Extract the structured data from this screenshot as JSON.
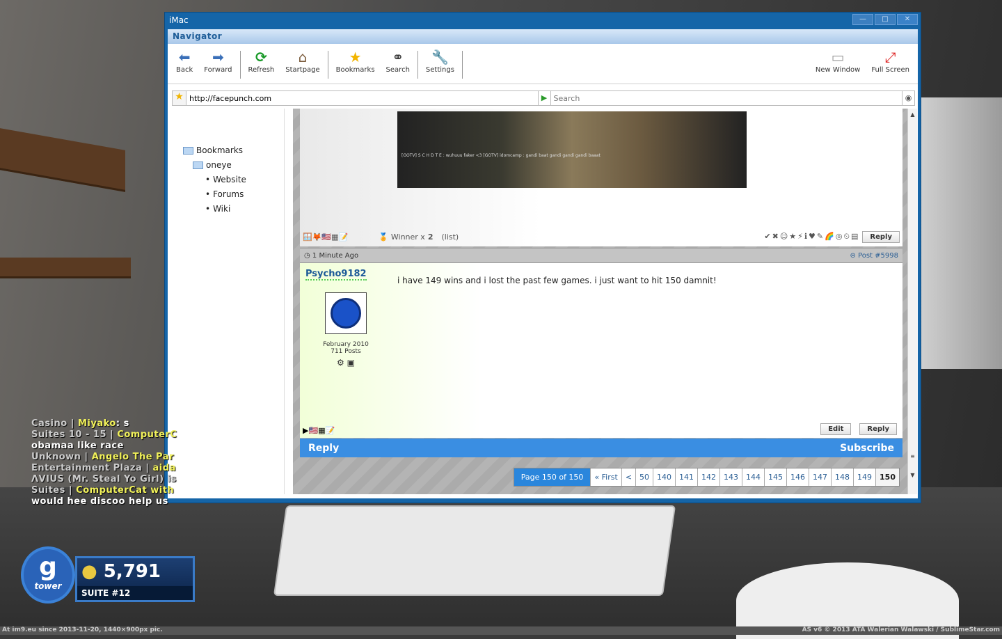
{
  "window": {
    "title": "iMac",
    "minimize": "—",
    "maximize": "□",
    "close": "✕"
  },
  "browser": {
    "header": "Navigator",
    "toolbar": [
      {
        "label": "Back",
        "icon": "⬅"
      },
      {
        "label": "Forward",
        "icon": "➡"
      },
      {
        "label": "Refresh",
        "icon": "⟳"
      },
      {
        "label": "Startpage",
        "icon": "⌂"
      },
      {
        "label": "Bookmarks",
        "icon": "★"
      },
      {
        "label": "Search",
        "icon": "⚭"
      },
      {
        "label": "Settings",
        "icon": "🔧"
      }
    ],
    "toolbar_right": [
      {
        "label": "New Window",
        "icon": "▭"
      },
      {
        "label": "Full Screen",
        "icon": "⤢"
      }
    ],
    "url": "http://facepunch.com",
    "search_placeholder": "Search"
  },
  "sidebar": {
    "root": "Bookmarks",
    "folder": "oneye",
    "items": [
      "Website",
      "Forums",
      "Wiki"
    ]
  },
  "post_prev": {
    "rating_label": "Winner x",
    "rating_count": "2",
    "list_link": "(list)",
    "reply": "Reply",
    "screenshot_text": "[GOTV] S C H D T E : wuhuuu faker <3 [GOTV] idomcamp : gandi baat gandi gandi gandi baaat"
  },
  "post": {
    "time": "1 Minute Ago",
    "post_number": "Post #5998",
    "username": "Psycho9182",
    "join_date": "February 2010",
    "posts": "711 Posts",
    "message": "i have 149 wins and i lost the past few games. i just want to hit 150 damnit!",
    "edit": "Edit",
    "reply": "Reply"
  },
  "thread_bar": {
    "reply": "Reply",
    "subscribe": "Subscribe"
  },
  "pagination": {
    "label": "Page 150 of 150",
    "first": "« First",
    "prev": "<",
    "pages": [
      "50",
      "140",
      "141",
      "142",
      "143",
      "144",
      "145",
      "146",
      "147",
      "148",
      "149"
    ],
    "current": "150"
  },
  "chat": [
    {
      "loc": "Casino | ",
      "name": "Miyako",
      "msg": ": s"
    },
    {
      "loc": "Suites 10 - 15 | ",
      "name": "ComputerC",
      "msg": ""
    },
    {
      "loc": "",
      "name": "",
      "msg": "obamaa like race"
    },
    {
      "loc": "Unknown | ",
      "name": "Angelo The Par",
      "msg": ""
    },
    {
      "loc": "Entertainment Plaza | ",
      "name": "aida",
      "msg": ""
    },
    {
      "loc": "ΛVIUS (Mr. Steal Yo Girl) is",
      "name": "",
      "msg": ""
    },
    {
      "loc": "Suites | ",
      "name": "ComputerCat with",
      "msg": ""
    },
    {
      "loc": "",
      "name": "",
      "msg": "would hee discoo help us"
    }
  ],
  "hud": {
    "logo_g": "g",
    "logo_text": "tower",
    "money": "5,791",
    "suite": "SUITE #12"
  },
  "watermark": {
    "left": "At im9.eu since 2013-11-20, 1440×900px pic.",
    "right": "AS v6 © 2013 ATA Walerian Walawski / SublimeStar.com"
  },
  "colors": {
    "title_bar": "#1565a8",
    "reply_bar": "#3a8ee2",
    "username": "#1c5a98",
    "chat_name": "#f2f25a"
  }
}
